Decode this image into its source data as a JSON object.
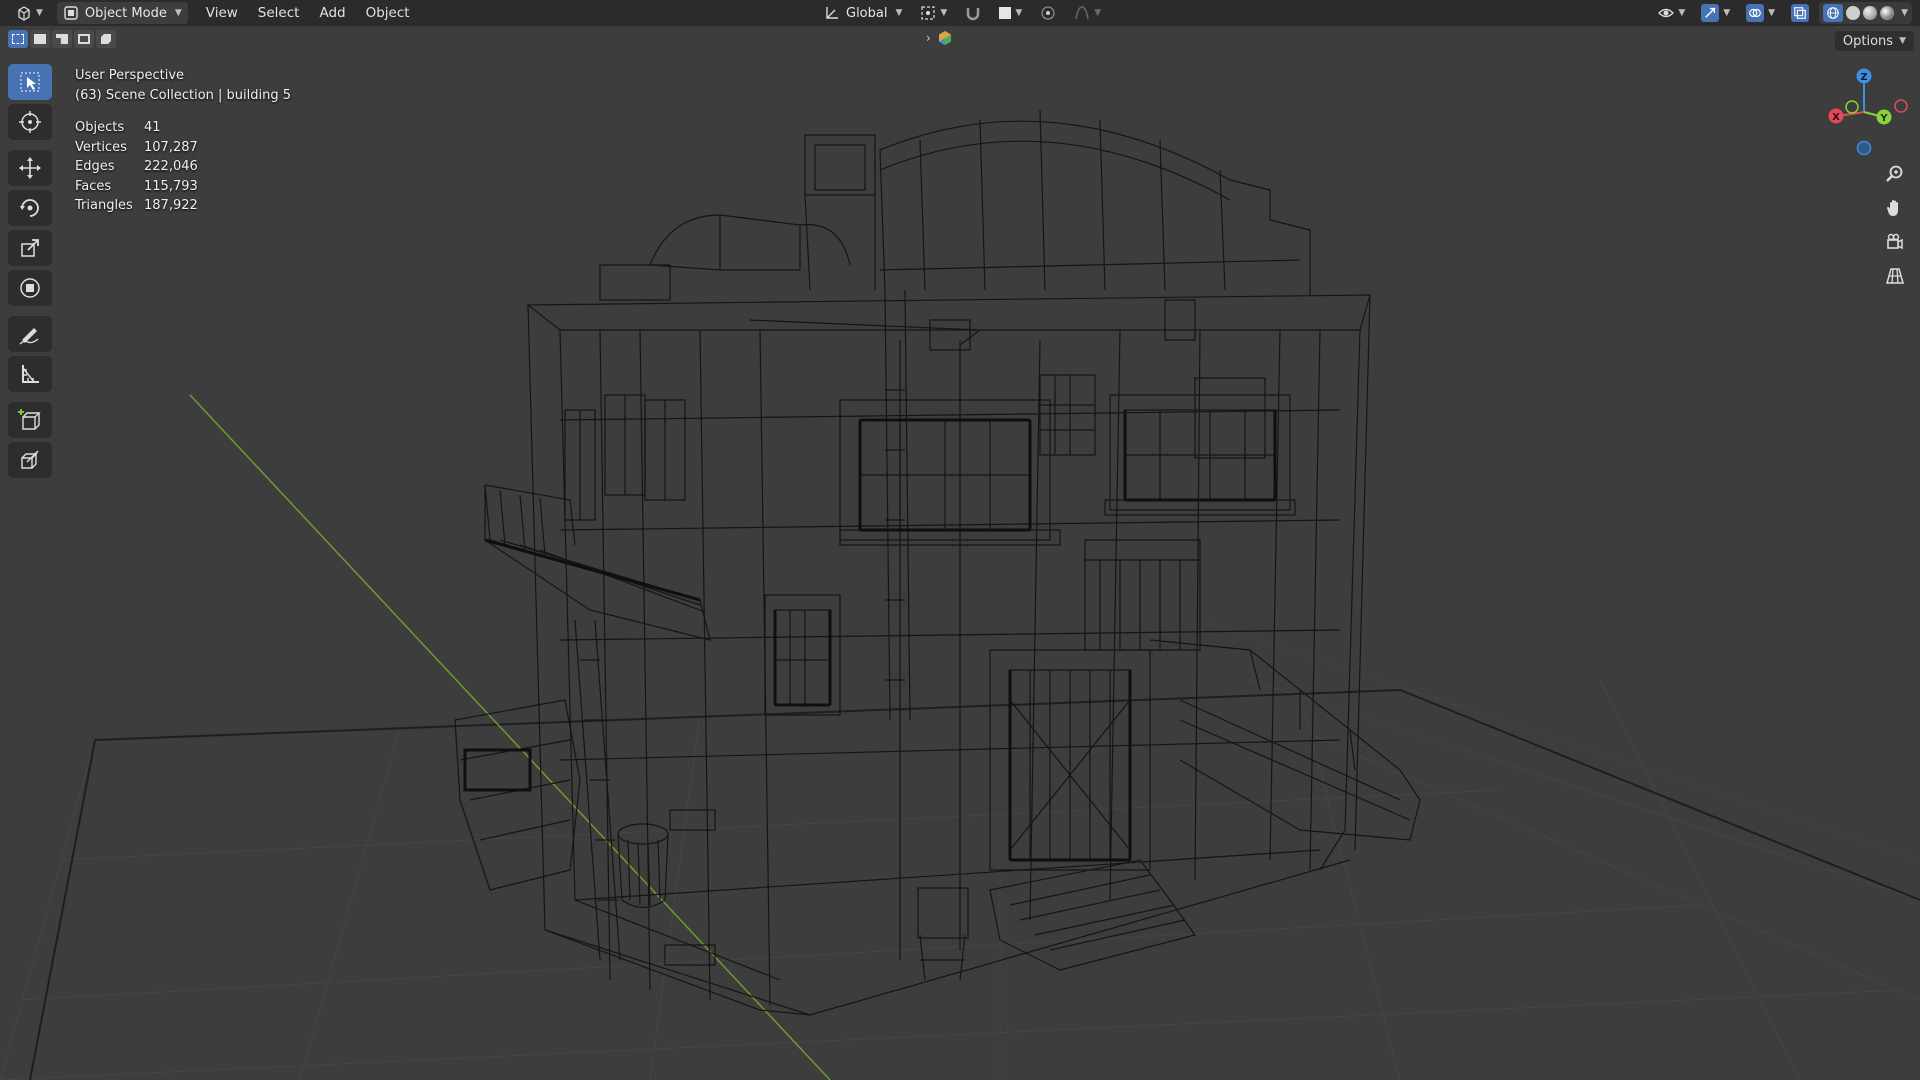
{
  "header": {
    "mode_label": "Object Mode",
    "menus": [
      "View",
      "Select",
      "Add",
      "Object"
    ],
    "orientation_label": "Global",
    "options_label": "Options"
  },
  "overlay": {
    "view_name": "User Perspective",
    "collection_info": "(63) Scene Collection | building 5"
  },
  "stats": [
    {
      "label": "Objects",
      "value": "41"
    },
    {
      "label": "Vertices",
      "value": "107,287"
    },
    {
      "label": "Edges",
      "value": "222,046"
    },
    {
      "label": "Faces",
      "value": "115,793"
    },
    {
      "label": "Triangles",
      "value": "187,922"
    }
  ],
  "gizmo": {
    "z_label": "Z",
    "y_label": "Y",
    "x_label": "X"
  },
  "colors": {
    "accent": "#4772b3",
    "x_axis": "#e04a5a",
    "y_axis": "#8ad13b",
    "z_axis": "#3f8fe0",
    "grid": "#4a4a4a",
    "wire": "#111111"
  }
}
